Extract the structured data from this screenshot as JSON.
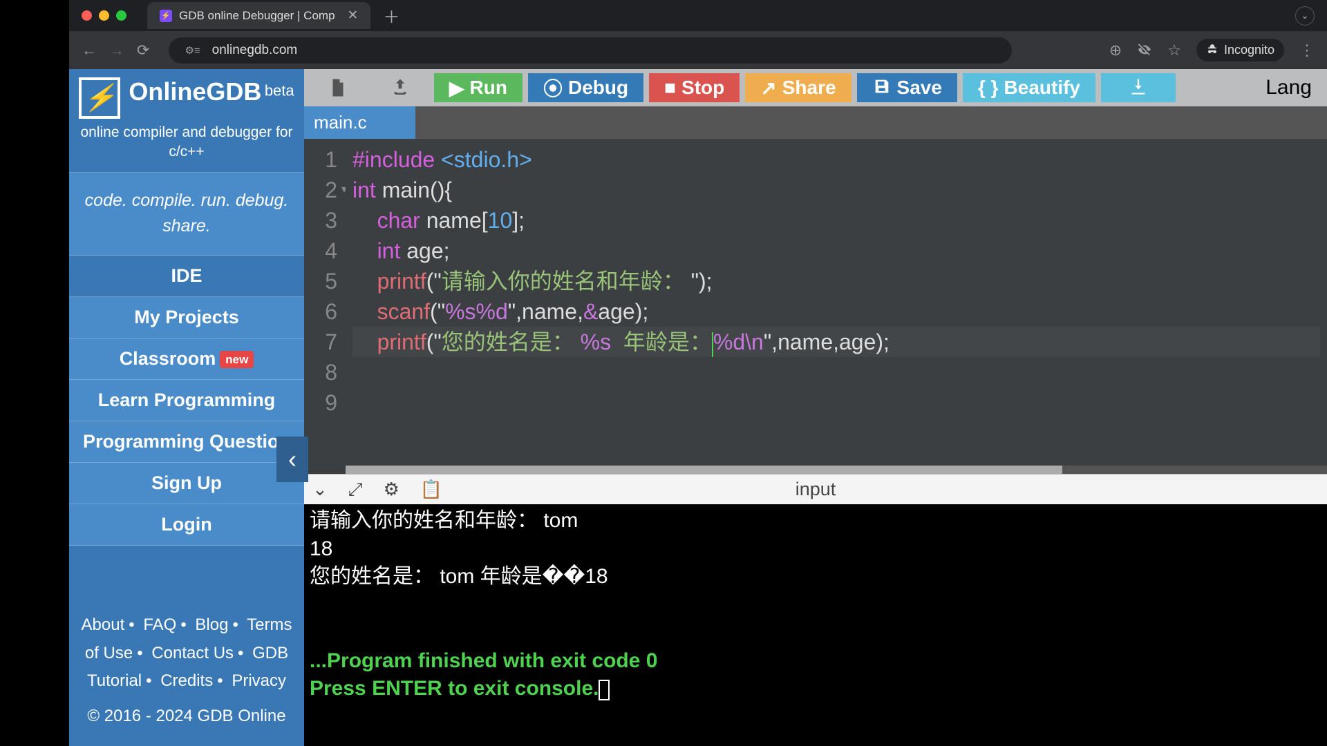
{
  "browser": {
    "tab_title": "GDB online Debugger | Comp",
    "url": "onlinegdb.com",
    "incognito": "Incognito"
  },
  "brand": {
    "name": "OnlineGDB",
    "beta": "beta",
    "subtitle": "online compiler and debugger for c/c++",
    "tagline": "code. compile. run. debug. share."
  },
  "sidebar": {
    "items": [
      {
        "label": "IDE"
      },
      {
        "label": "My Projects"
      },
      {
        "label": "Classroom",
        "badge": "new"
      },
      {
        "label": "Learn Programming"
      },
      {
        "label": "Programming Question"
      },
      {
        "label": "Sign Up"
      },
      {
        "label": "Login"
      }
    ],
    "footer": [
      "About",
      "FAQ",
      "Blog",
      "Terms of Use",
      "Contact Us",
      "GDB Tutorial",
      "Credits",
      "Privacy"
    ],
    "copyright": "© 2016 - 2024 GDB Online"
  },
  "toolbar": {
    "run": "Run",
    "debug": "Debug",
    "stop": "Stop",
    "share": "Share",
    "save": "Save",
    "beautify": "Beautify",
    "language_prefix": "Lang"
  },
  "file_tab": "main.c",
  "code": {
    "lines": [
      {
        "n": "1"
      },
      {
        "n": "2"
      },
      {
        "n": "3"
      },
      {
        "n": "4"
      },
      {
        "n": "5"
      },
      {
        "n": "6"
      },
      {
        "n": "7"
      },
      {
        "n": "8"
      },
      {
        "n": "9"
      }
    ],
    "l1_include": "#include",
    "l1_header": " <stdio.h>",
    "l2_a": "int",
    "l2_b": " main(){",
    "l3_a": "    char",
    "l3_b": " name[",
    "l3_num": "10",
    "l3_c": "];",
    "l4_a": "    int",
    "l4_b": " age;",
    "l5_func": "    printf",
    "l5_str_a": "(\"",
    "l5_str_b": "请输入你的姓名和年龄：",
    "l5_str_c": " \"",
    "l5_end": ");",
    "l6_func": "    scanf",
    "l6_a": "(\"",
    "l6_fmt": "%s%d",
    "l6_b": "\",name,",
    "l6_amp": "&",
    "l6_c": "age);",
    "l7_func": "    printf",
    "l7_a": "(\"",
    "l7_str1": "您的姓名是：",
    "l7_fmt1": " %s ",
    "l7_str2": " 年龄是：",
    "l7_fmt2": "%d",
    "l7_esc": "\\n",
    "l7_b": "\",name,age);"
  },
  "io_title": "input",
  "console": {
    "line1": "请输入你的姓名和年龄： tom",
    "line2": "18",
    "line3": "您的姓名是： tom 年龄是��18",
    "blank": "",
    "finished": "...Program finished with exit code 0",
    "press_enter": "Press ENTER to exit console."
  }
}
